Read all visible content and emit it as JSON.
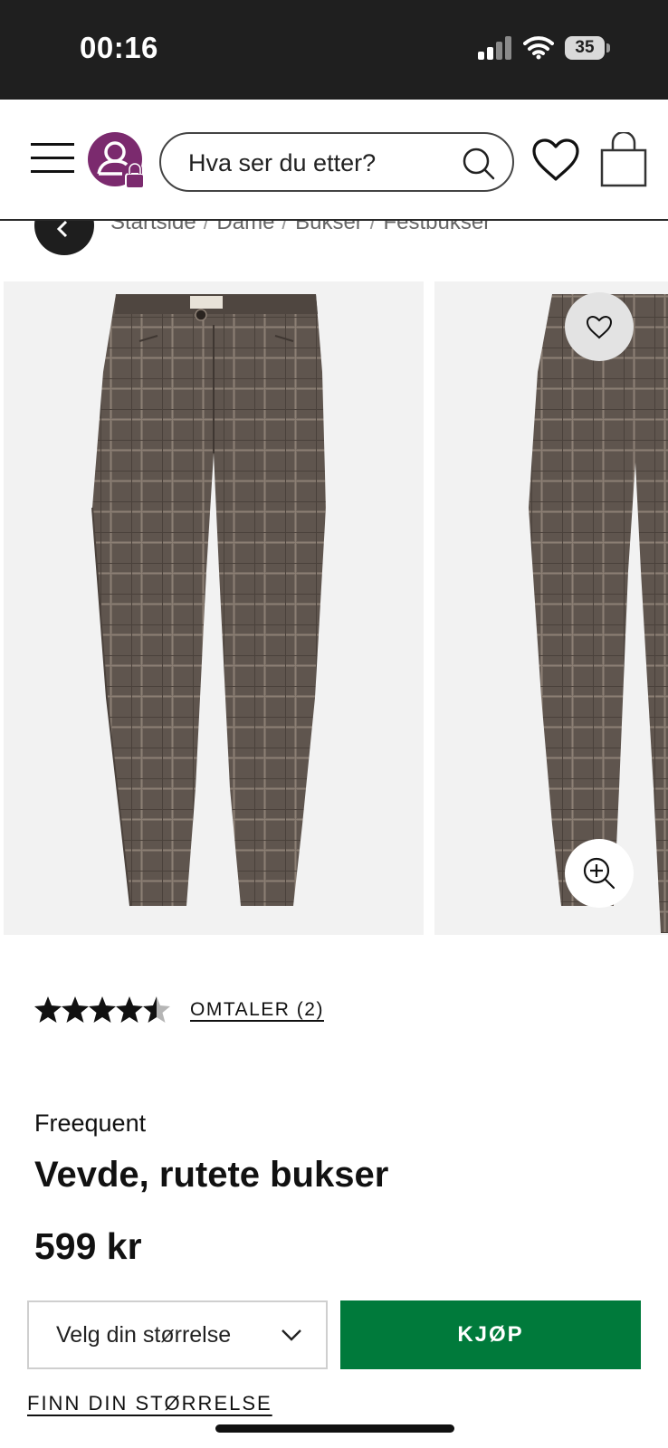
{
  "status_bar": {
    "time": "00:16",
    "battery": "35",
    "icons": [
      "signal-icon",
      "wifi-icon",
      "battery-icon"
    ]
  },
  "header": {
    "search_placeholder": "Hva ser du etter?",
    "icons": [
      "menu-icon",
      "account-locked-icon",
      "search-icon",
      "heart-icon",
      "shopping-bag-icon"
    ]
  },
  "breadcrumb": {
    "items": [
      "Startside",
      "Dame",
      "Bukser",
      "Festbukser"
    ],
    "separator": "/"
  },
  "gallery": {
    "icons": [
      "heart-icon",
      "zoom-in-icon"
    ]
  },
  "product": {
    "rating": 4.5,
    "reviews_label": "OMTALER (2)",
    "brand": "Freequent",
    "title": "Vevde, rutete bukser",
    "price": "599 kr",
    "size_select_label": "Velg din størrelse",
    "buy_label": "KJØP",
    "size_guide_label": "FINN DIN STØRRELSE"
  },
  "colors": {
    "accent_green": "#007a3b",
    "account_purple": "#7b2a6e",
    "status_bar_bg": "#1f1f1f",
    "image_bg": "#f2f2f2"
  }
}
